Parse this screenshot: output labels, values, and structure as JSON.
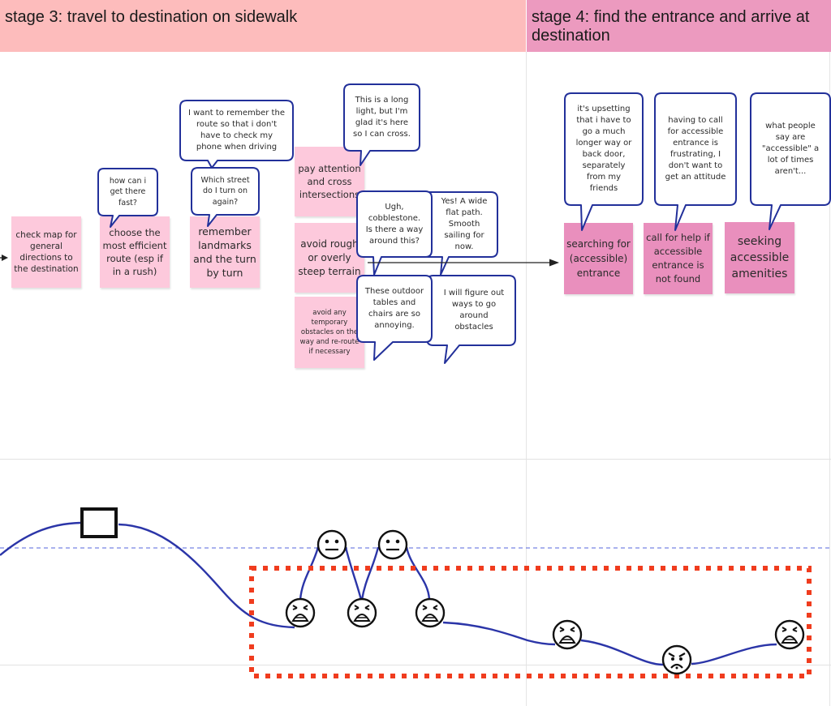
{
  "stages": {
    "stage3": {
      "title": "stage 3: travel to destination on sidewalk",
      "color": "#fdbcbc"
    },
    "stage4": {
      "title": "stage 4: find the entrance and arrive at destination",
      "color": "#ec9abf"
    }
  },
  "actions": {
    "stage3": [
      {
        "text": "check map for general directions to the destination"
      },
      {
        "text": "choose the most efficient route (esp if in a rush)"
      },
      {
        "text": "remember landmarks and the turn by turn"
      },
      {
        "text": "pay attention and cross intersections"
      },
      {
        "text": "avoid rough or overly steep terrain"
      },
      {
        "text": "avoid any temporary obstacles on the way and re-route if necessary"
      }
    ],
    "stage4": [
      {
        "text": "searching for (accessible) entrance"
      },
      {
        "text": "call for help if accessible entrance is not found"
      },
      {
        "text": "seeking accessible amenities"
      }
    ]
  },
  "thoughts": [
    {
      "text": "how can i get there fast?"
    },
    {
      "text": "I want to remember the route so that i don't have to check my phone when driving"
    },
    {
      "text": "Which street do I turn on again?"
    },
    {
      "text": "This is a long light, but I'm glad it's here so I can cross."
    },
    {
      "text": "Ugh, cobblestone. Is there a way around this?"
    },
    {
      "text": "Yes! A wide flat path. Smooth sailing for now."
    },
    {
      "text": "These outdoor tables and chairs are so annoying."
    },
    {
      "text": "I will figure out ways to go around obstacles"
    },
    {
      "text": "it's upsetting that i have to go a much longer way or back door, separately from my friends"
    },
    {
      "text": "having to call for accessible entrance is frustrating, I don't want to get an attitude"
    },
    {
      "text": "what people say are \"accessible\" a lot of times aren't..."
    }
  ],
  "emotion_curve": {
    "line_color": "#2b35a8",
    "highlight_color": "#f03c1e",
    "points": [
      {
        "icon": "neutral-box",
        "mood": "neutral"
      },
      {
        "icon": "distressed-face",
        "mood": "negative"
      },
      {
        "icon": "neutral-face",
        "mood": "neutral"
      },
      {
        "icon": "distressed-face",
        "mood": "negative"
      },
      {
        "icon": "neutral-face",
        "mood": "neutral"
      },
      {
        "icon": "distressed-face",
        "mood": "negative"
      },
      {
        "icon": "distressed-face",
        "mood": "negative"
      },
      {
        "icon": "angry-face",
        "mood": "very negative"
      },
      {
        "icon": "distressed-face",
        "mood": "negative"
      }
    ]
  },
  "colors": {
    "bubble_border": "#22309a",
    "sticky_stage3": "#fdc9dc",
    "sticky_stage4": "#e98fbd"
  }
}
